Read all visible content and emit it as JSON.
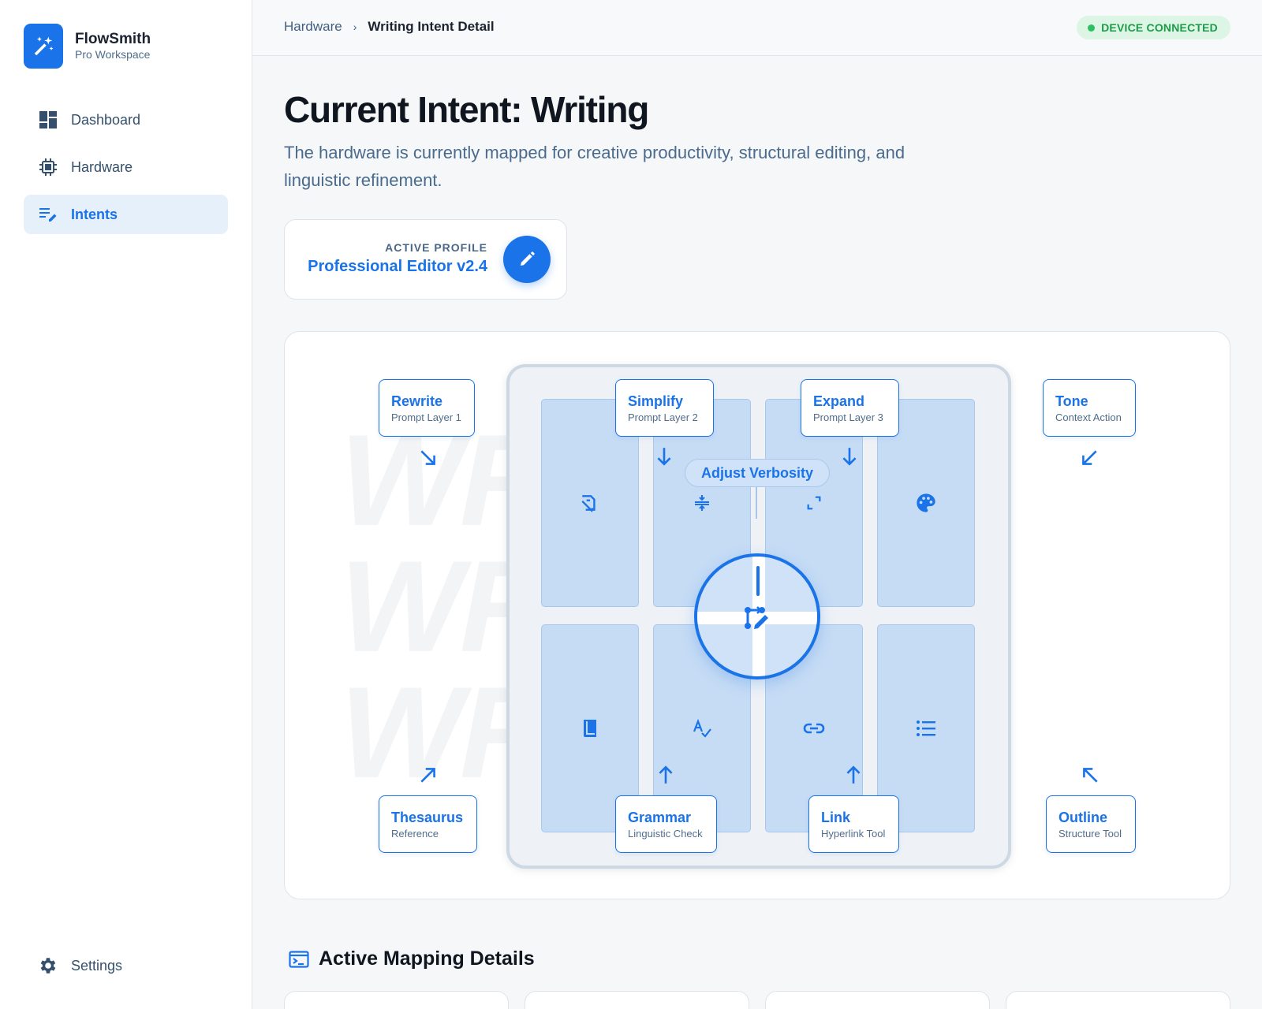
{
  "brand": {
    "name": "FlowSmith",
    "subtitle": "Pro Workspace"
  },
  "nav": {
    "items": [
      {
        "label": "Dashboard",
        "icon": "dashboard-icon"
      },
      {
        "label": "Hardware",
        "icon": "chip-icon"
      },
      {
        "label": "Intents",
        "icon": "edit-note-icon",
        "active": true
      }
    ],
    "settings": "Settings"
  },
  "breadcrumb": {
    "parent": "Hardware",
    "current": "Writing Intent Detail"
  },
  "status": {
    "label": "DEVICE CONNECTED",
    "color": "#1f9a4b"
  },
  "header": {
    "title": "Current Intent: Writing",
    "description": "The hardware is currently mapped for creative productivity, structural editing, and linguistic refinement."
  },
  "profile": {
    "label": "ACTIVE PROFILE",
    "name": "Professional Editor v2.4"
  },
  "device": {
    "watermark": [
      "WR",
      "WR",
      "WR"
    ],
    "dial_label": "Adjust Verbosity",
    "callouts": [
      {
        "title": "Rewrite",
        "subtitle": "Prompt Layer 1"
      },
      {
        "title": "Simplify",
        "subtitle": "Prompt Layer 2"
      },
      {
        "title": "Expand",
        "subtitle": "Prompt Layer 3"
      },
      {
        "title": "Tone",
        "subtitle": "Context Action"
      },
      {
        "title": "Thesaurus",
        "subtitle": "Reference"
      },
      {
        "title": "Grammar",
        "subtitle": "Linguistic Check"
      },
      {
        "title": "Link",
        "subtitle": "Hyperlink Tool"
      },
      {
        "title": "Outline",
        "subtitle": "Structure Tool"
      }
    ],
    "keys": [
      {
        "icon": "edit-document-icon"
      },
      {
        "icon": "compress-icon"
      },
      {
        "icon": "expand-icon"
      },
      {
        "icon": "palette-icon"
      },
      {
        "icon": "book-icon"
      },
      {
        "icon": "spellcheck-icon"
      },
      {
        "icon": "link-icon"
      },
      {
        "icon": "list-icon"
      }
    ],
    "accent": "#1a73e8"
  },
  "section": {
    "title": "Active Mapping Details"
  }
}
